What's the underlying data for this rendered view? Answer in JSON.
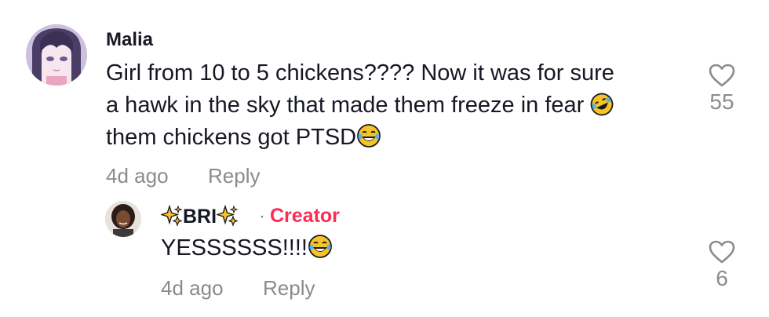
{
  "comment": {
    "username": "Malia",
    "text_lines": [
      "Girl from 10 to 5 chickens???? Now it was for sure",
      "a hawk in the sky that made them freeze in fear",
      "them chickens got PTSD"
    ],
    "time": "4d ago",
    "reply_label": "Reply",
    "like_count": "55"
  },
  "reply": {
    "username": "BRI",
    "separator": "·",
    "badge": "Creator",
    "text": "YESSSSSS!!!!",
    "time": "4d ago",
    "reply_label": "Reply",
    "like_count": "6"
  },
  "colors": {
    "text": "#161823",
    "muted": "#8a8b91",
    "creator": "#fe2c55"
  },
  "icons": [
    "heart-outline-icon",
    "rofl-emoji",
    "joy-emoji",
    "sparkles-emoji"
  ]
}
